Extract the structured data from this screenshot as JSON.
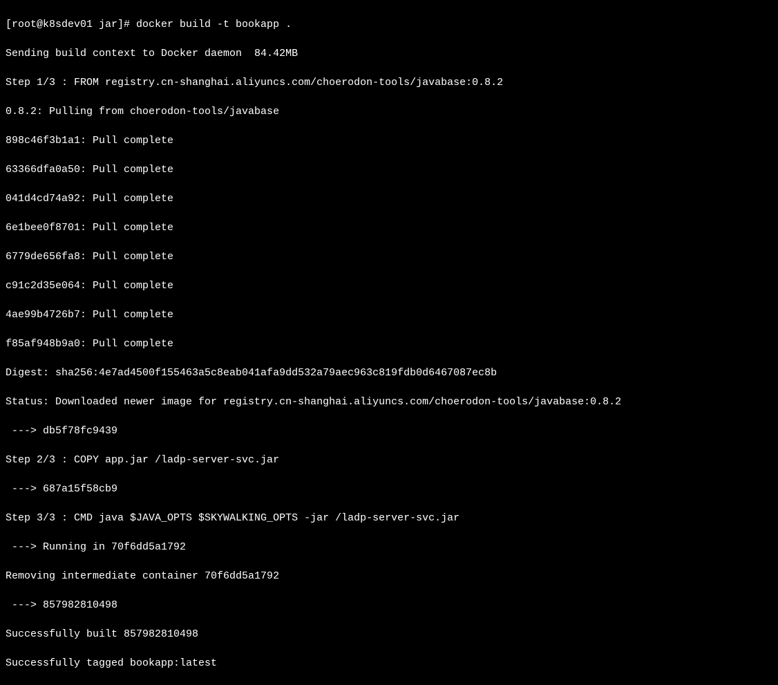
{
  "terminal": {
    "prompt": "[root@k8sdev01 jar]# ",
    "command": "docker build -t bookapp .",
    "lines": [
      "Sending build context to Docker daemon  84.42MB",
      "Step 1/3 : FROM registry.cn-shanghai.aliyuncs.com/choerodon-tools/javabase:0.8.2",
      "0.8.2: Pulling from choerodon-tools/javabase",
      "898c46f3b1a1: Pull complete",
      "63366dfa0a50: Pull complete",
      "041d4cd74a92: Pull complete",
      "6e1bee0f8701: Pull complete",
      "6779de656fa8: Pull complete",
      "c91c2d35e064: Pull complete",
      "4ae99b4726b7: Pull complete",
      "f85af948b9a0: Pull complete",
      "Digest: sha256:4e7ad4500f155463a5c8eab041afa9dd532a79aec963c819fdb0d6467087ec8b",
      "Status: Downloaded newer image for registry.cn-shanghai.aliyuncs.com/choerodon-tools/javabase:0.8.2",
      " ---> db5f78fc9439",
      "Step 2/3 : COPY app.jar /ladp-server-svc.jar",
      " ---> 687a15f58cb9",
      "Step 3/3 : CMD java $JAVA_OPTS $SKYWALKING_OPTS -jar /ladp-server-svc.jar",
      " ---> Running in 70f6dd5a1792",
      "Removing intermediate container 70f6dd5a1792",
      " ---> 857982810498",
      "Successfully built 857982810498",
      "Successfully tagged bookapp:latest"
    ]
  }
}
